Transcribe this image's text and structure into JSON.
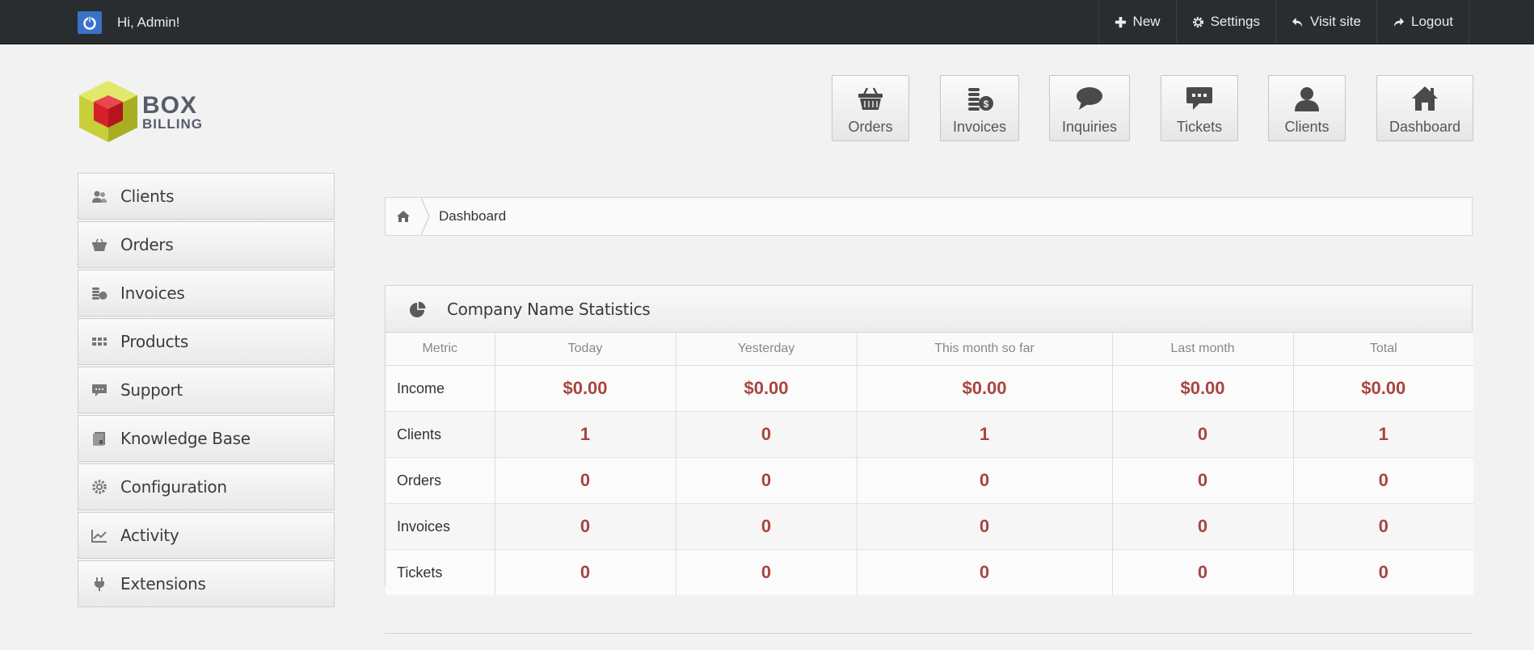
{
  "topbar": {
    "greeting": "Hi, Admin!",
    "nav": [
      {
        "label": "New",
        "icon": "plus-icon"
      },
      {
        "label": "Settings",
        "icon": "gear-icon"
      },
      {
        "label": "Visit site",
        "icon": "reply-icon"
      },
      {
        "label": "Logout",
        "icon": "forward-icon"
      }
    ]
  },
  "logo": {
    "line1": "BOX",
    "line2": "BILLING"
  },
  "shortcuts": [
    {
      "label": "Orders",
      "icon": "basket-icon"
    },
    {
      "label": "Invoices",
      "icon": "coins-icon"
    },
    {
      "label": "Inquiries",
      "icon": "speech-bubble-icon"
    },
    {
      "label": "Tickets",
      "icon": "chat-icon"
    },
    {
      "label": "Clients",
      "icon": "user-icon"
    },
    {
      "label": "Dashboard",
      "icon": "home-icon"
    }
  ],
  "sidebar": {
    "items": [
      {
        "label": "Clients",
        "icon": "users-icon"
      },
      {
        "label": "Orders",
        "icon": "basket-icon"
      },
      {
        "label": "Invoices",
        "icon": "coins-icon"
      },
      {
        "label": "Products",
        "icon": "grid-icon"
      },
      {
        "label": "Support",
        "icon": "chat-icon"
      },
      {
        "label": "Knowledge Base",
        "icon": "book-icon"
      },
      {
        "label": "Configuration",
        "icon": "gear-icon"
      },
      {
        "label": "Activity",
        "icon": "chart-icon"
      },
      {
        "label": "Extensions",
        "icon": "plug-icon"
      }
    ]
  },
  "breadcrumb": {
    "current": "Dashboard"
  },
  "stats": {
    "title": "Company Name Statistics",
    "columns": [
      "Metric",
      "Today",
      "Yesterday",
      "This month so far",
      "Last month",
      "Total"
    ],
    "rows": [
      {
        "metric": "Income",
        "values": [
          "$0.00",
          "$0.00",
          "$0.00",
          "$0.00",
          "$0.00"
        ]
      },
      {
        "metric": "Clients",
        "values": [
          "1",
          "0",
          "1",
          "0",
          "1"
        ]
      },
      {
        "metric": "Orders",
        "values": [
          "0",
          "0",
          "0",
          "0",
          "0"
        ]
      },
      {
        "metric": "Invoices",
        "values": [
          "0",
          "0",
          "0",
          "0",
          "0"
        ]
      },
      {
        "metric": "Tickets",
        "values": [
          "0",
          "0",
          "0",
          "0",
          "0"
        ]
      }
    ]
  },
  "colors": {
    "topbar": "#2a2d30",
    "accent_blue": "#3a72c8",
    "value_red": "#a94442"
  }
}
